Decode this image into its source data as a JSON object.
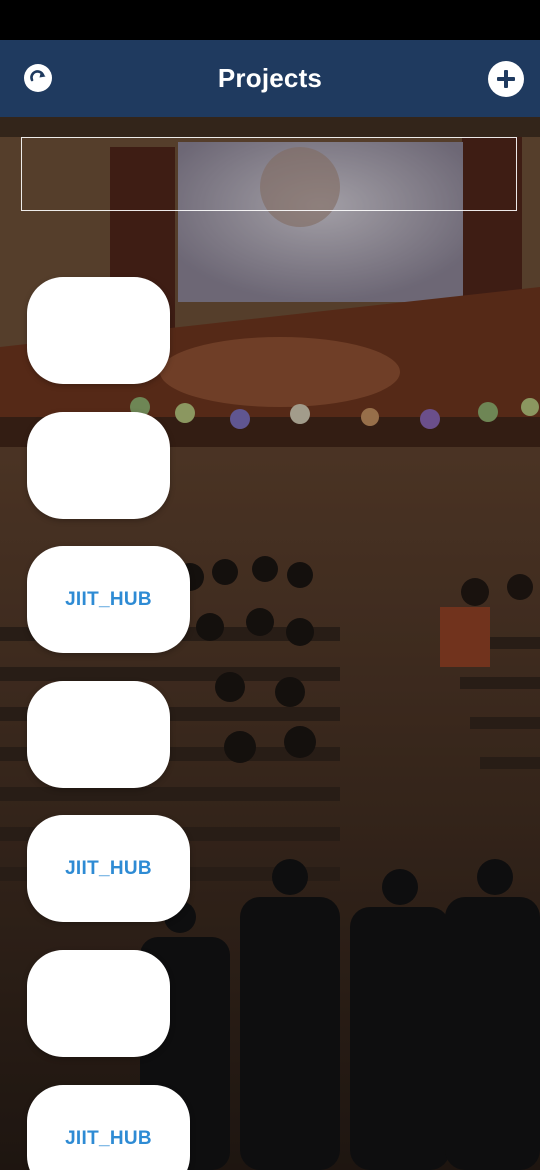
{
  "app_bar": {
    "title": "Projects",
    "refresh_icon": "refresh-icon",
    "add_icon": "plus-icon",
    "color": "#1f3a5f"
  },
  "search": {
    "value": ""
  },
  "projects": [
    {
      "label": ""
    },
    {
      "label": ""
    },
    {
      "label": "JIIT_HUB"
    },
    {
      "label": ""
    },
    {
      "label": "JIIT_HUB"
    },
    {
      "label": ""
    },
    {
      "label": "JIIT_HUB"
    }
  ],
  "colors": {
    "accent_text": "#2e8bd4",
    "card_bg": "#ffffff"
  }
}
